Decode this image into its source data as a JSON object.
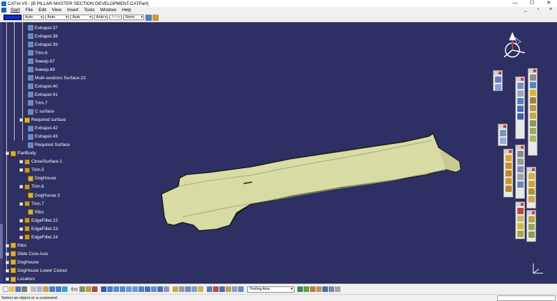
{
  "window": {
    "title": "CATIA V5 - [B PILLAR MASTER SECTION DEVELOPMENT.CATPart]",
    "controls": {
      "minimize": "—",
      "maximize": "☐",
      "close": "✕"
    }
  },
  "menu": {
    "items": [
      "Start",
      "File",
      "Edit",
      "View",
      "Insert",
      "Tools",
      "Window",
      "Help"
    ],
    "right_controls": {
      "minimize": "_",
      "restore": "▫",
      "close": "×"
    }
  },
  "properties_toolbar": {
    "color_value": "#0a2ad6",
    "transparency": "Auto",
    "linetype": "Auto",
    "thickness": "Auto",
    "symbol": "Auto",
    "layer_disabled": "Auto",
    "layer": "None"
  },
  "tree": {
    "items": [
      {
        "label": "Extrapol.37",
        "icon": "surface",
        "level": 2
      },
      {
        "label": "Extrapol.38",
        "icon": "surface",
        "level": 2
      },
      {
        "label": "Extrapol.39",
        "icon": "surface",
        "level": 2
      },
      {
        "label": "Trim.6",
        "icon": "surface",
        "level": 2
      },
      {
        "label": "Sweep.67",
        "icon": "surface",
        "level": 2
      },
      {
        "label": "Sweep.69",
        "icon": "surface",
        "level": 2
      },
      {
        "label": "Multi-sections Surface.23",
        "icon": "surface",
        "level": 2
      },
      {
        "label": "Extrapol.40",
        "icon": "surface",
        "level": 2
      },
      {
        "label": "Extrapol.41",
        "icon": "surface",
        "level": 2
      },
      {
        "label": "Trim.7",
        "icon": "surface",
        "level": 2
      },
      {
        "label": "C surface",
        "icon": "surface",
        "level": 2
      },
      {
        "label": "Required surface",
        "icon": "geoset",
        "level": 1
      },
      {
        "label": "Extrapol.42",
        "icon": "surface",
        "level": 2
      },
      {
        "label": "Extrapol.43",
        "icon": "surface",
        "level": 2
      },
      {
        "label": "Required Surface",
        "icon": "surface",
        "level": 2
      },
      {
        "label": "PartBody",
        "icon": "body",
        "level": 0
      },
      {
        "label": "CloseSurface.1",
        "icon": "solid",
        "level": 1
      },
      {
        "label": "Trim.5",
        "icon": "solid",
        "level": 1
      },
      {
        "label": "DogHouse",
        "icon": "body",
        "level": 2
      },
      {
        "label": "Trim.6",
        "icon": "solid",
        "level": 1
      },
      {
        "label": "DogHouse 2",
        "icon": "body",
        "level": 2
      },
      {
        "label": "Trim.7",
        "icon": "solid",
        "level": 1
      },
      {
        "label": "Ribs",
        "icon": "body",
        "level": 2
      },
      {
        "label": "EdgeFillet.22",
        "icon": "solid",
        "level": 1
      },
      {
        "label": "EdgeFillet.23",
        "icon": "solid",
        "level": 1
      },
      {
        "label": "EdgeFillet.24",
        "icon": "solid",
        "level": 1
      },
      {
        "label": "Ribs",
        "icon": "body",
        "level": 0
      },
      {
        "label": "Slide Core Axis",
        "icon": "body",
        "level": 0
      },
      {
        "label": "DogHouse",
        "icon": "body",
        "level": 0
      },
      {
        "label": "DogHouse Lower Cutout",
        "icon": "body",
        "level": 0
      },
      {
        "label": "Locators",
        "icon": "body",
        "level": 0
      }
    ]
  },
  "bottom_toolbar": {
    "fx_label": "f(x)",
    "axis_select": "Tooling Axis"
  },
  "status": {
    "message": "Select an object or a command"
  }
}
